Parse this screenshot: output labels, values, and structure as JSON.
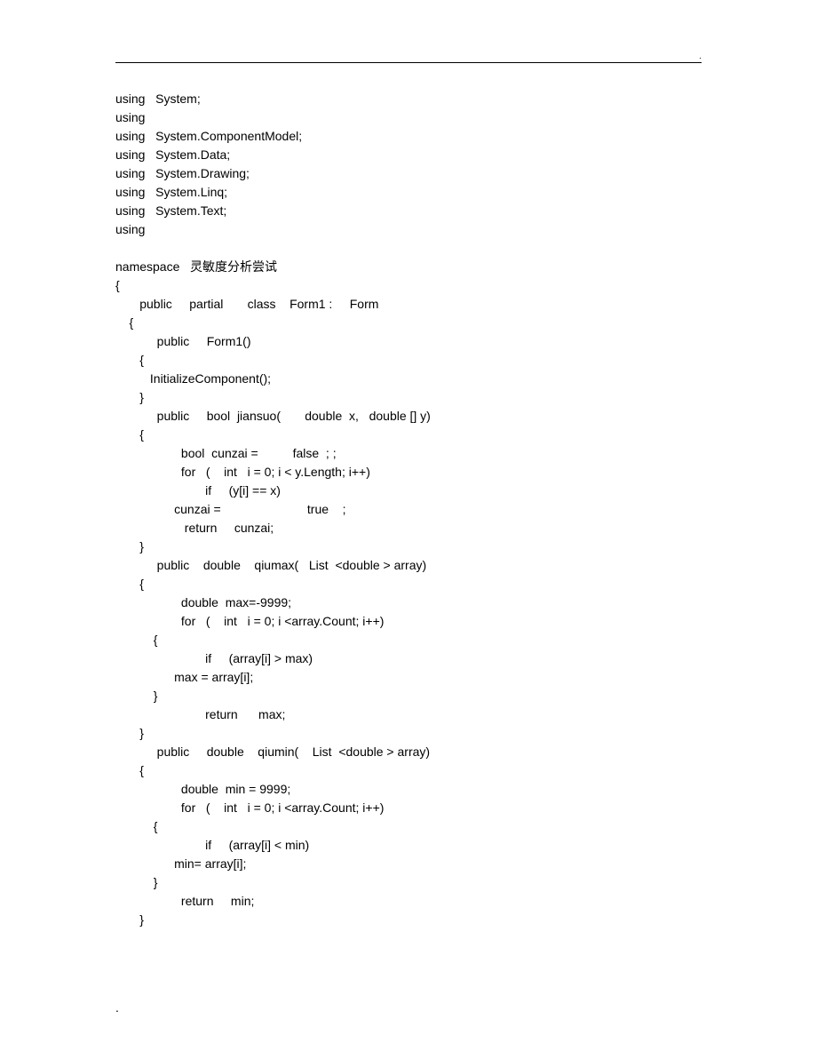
{
  "code_lines": [
    "using   System;",
    "using",
    "using   System.ComponentModel;",
    "using   System.Data;",
    "using   System.Drawing;",
    "using   System.Linq;",
    "using   System.Text;",
    "using",
    "",
    "namespace   灵敏度分析尝试",
    "{",
    "       public     partial       class    Form1 :     Form",
    "    {",
    "            public     Form1()",
    "       {",
    "          InitializeComponent();",
    "       }",
    "            public     bool  jiansuo(       double  x,   double [] y)",
    "       {",
    "                   bool  cunzai =          false  ; ;",
    "                   for   (    int   i = 0; i < y.Length; i++)",
    "                          if     (y[i] == x)",
    "                 cunzai =                         true    ;",
    "                    return     cunzai;",
    "       }",
    "            public    double    qiumax(   List  <double > array)",
    "       {",
    "                   double  max=-9999;",
    "                   for   (    int   i = 0; i <array.Count; i++)",
    "           {",
    "                          if     (array[i] > max)",
    "                 max = array[i];",
    "           }",
    "                          return      max;",
    "       }",
    "            public     double    qiumin(    List  <double > array)",
    "       {",
    "                   double  min = 9999;",
    "                   for   (    int   i = 0; i <array.Count; i++)",
    "           {",
    "                          if     (array[i] < min)",
    "                 min= array[i];",
    "           }",
    "                   return     min;",
    "       }"
  ],
  "footer": ".",
  "top_corner": "."
}
